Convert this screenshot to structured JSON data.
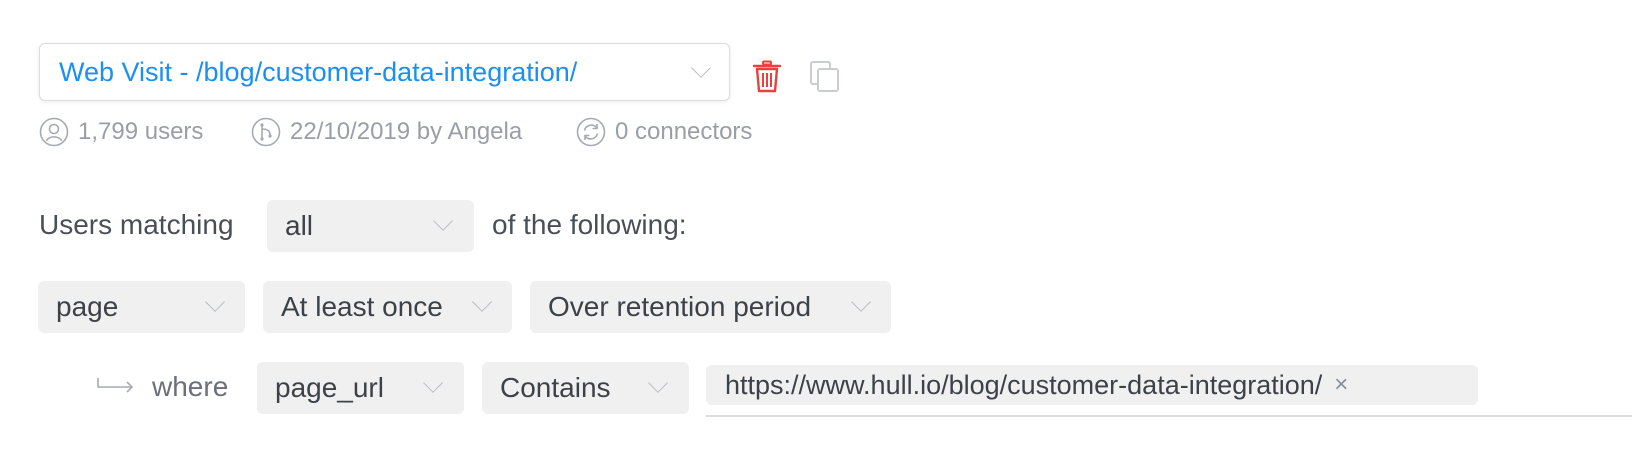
{
  "segment": {
    "title": "Web Visit - /blog/customer-data-integration/",
    "users": "1,799 users",
    "updated": "22/10/2019 by Angela",
    "connectors": "0 connectors"
  },
  "actions": {
    "delete_icon": "trash-icon",
    "duplicate_icon": "copy-icon"
  },
  "match": {
    "prefix": "Users matching",
    "mode": "all",
    "suffix": "of the following:"
  },
  "criteria": {
    "event": "page",
    "frequency": "At least once",
    "period": "Over retention period"
  },
  "condition": {
    "arrow_icon": "subcondition-arrow-icon",
    "label": "where",
    "property": "page_url",
    "operator": "Contains",
    "value": "https://www.hull.io/blog/customer-data-integration/",
    "remove_symbol": "×"
  },
  "colors": {
    "accent": "#1d8ff0",
    "danger": "#e8423d",
    "muted": "#9a9ea6",
    "chip_bg": "#f0f0f1"
  }
}
